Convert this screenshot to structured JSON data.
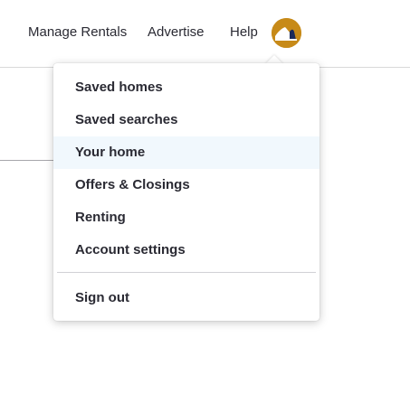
{
  "nav": {
    "manage_rentals": "Manage Rentals",
    "advertise": "Advertise",
    "help": "Help"
  },
  "avatar": {
    "icon": "user-avatar-icon",
    "background_color": "#c78a18"
  },
  "menu": {
    "items": [
      {
        "label": "Saved homes"
      },
      {
        "label": "Saved searches"
      },
      {
        "label": "Your home",
        "highlighted": true
      },
      {
        "label": "Offers & Closings"
      },
      {
        "label": "Renting"
      },
      {
        "label": "Account settings"
      }
    ],
    "sign_out": "Sign out",
    "highlight_color": "#f1f8fd"
  }
}
